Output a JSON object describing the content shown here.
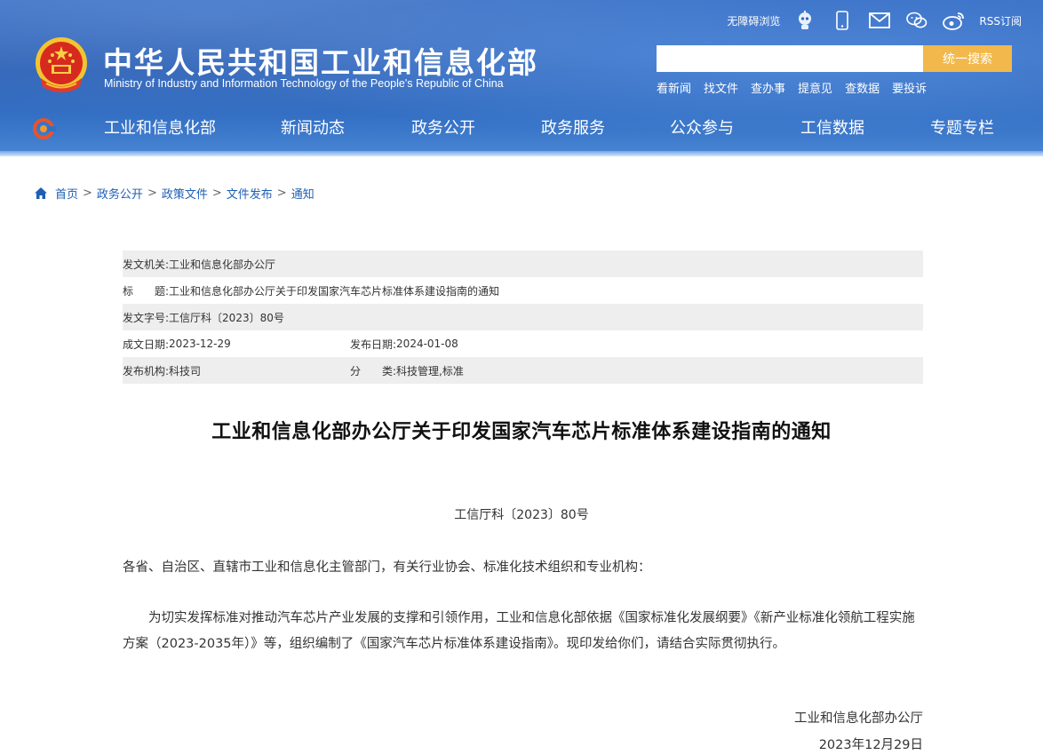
{
  "header": {
    "site_title_cn": "中华人民共和国工业和信息化部",
    "site_title_en": "Ministry of Industry and Information Technology of the People's Republic of China",
    "accessibility_label": "无障碍浏览",
    "rss_label": "RSS订阅",
    "icons": [
      "robot-icon",
      "mobile-icon",
      "mail-icon",
      "wechat-icon",
      "weibo-icon"
    ],
    "search": {
      "placeholder": "",
      "button_label": "统一搜索"
    },
    "quick_links": [
      "看新闻",
      "找文件",
      "查办事",
      "提意见",
      "查数据",
      "要投诉"
    ],
    "colors": {
      "header_blue": "#3470c4",
      "search_button": "#f2b84b",
      "link_blue": "#1e5fb4"
    }
  },
  "nav": {
    "items": [
      "工业和信息化部",
      "新闻动态",
      "政务公开",
      "政务服务",
      "公众参与",
      "工信数据",
      "专题专栏"
    ]
  },
  "breadcrumb": {
    "items": [
      "首页",
      "政务公开",
      "政策文件",
      "文件发布",
      "通知"
    ],
    "separator": ">"
  },
  "meta": {
    "issuer_label": "发文机关:",
    "issuer": "工业和信息化部办公厅",
    "title_label": "标　　题:",
    "title": "工业和信息化部办公厅关于印发国家汽车芯片标准体系建设指南的通知",
    "doc_no_label": "发文字号:",
    "doc_no": "工信厅科〔2023〕80号",
    "created_label": "成文日期:",
    "created": "2023-12-29",
    "published_label": "发布日期:",
    "published": "2024-01-08",
    "org_label": "发布机构:",
    "org": "科技司",
    "category_label": "分　　类:",
    "category": "科技管理,标准"
  },
  "document": {
    "title": "工业和信息化部办公厅关于印发国家汽车芯片标准体系建设指南的通知",
    "number": "工信厅科〔2023〕80号",
    "salutation": "各省、自治区、直辖市工业和信息化主管部门，有关行业协会、标准化技术组织和专业机构：",
    "body": "为切实发挥标准对推动汽车芯片产业发展的支撑和引领作用，工业和信息化部依据《国家标准化发展纲要》《新产业标准化领航工程实施方案（2023-2035年）》等，组织编制了《国家汽车芯片标准体系建设指南》。现印发给你们，请结合实际贯彻执行。",
    "signature": "工业和信息化部办公厅",
    "date": "2023年12月29日"
  }
}
